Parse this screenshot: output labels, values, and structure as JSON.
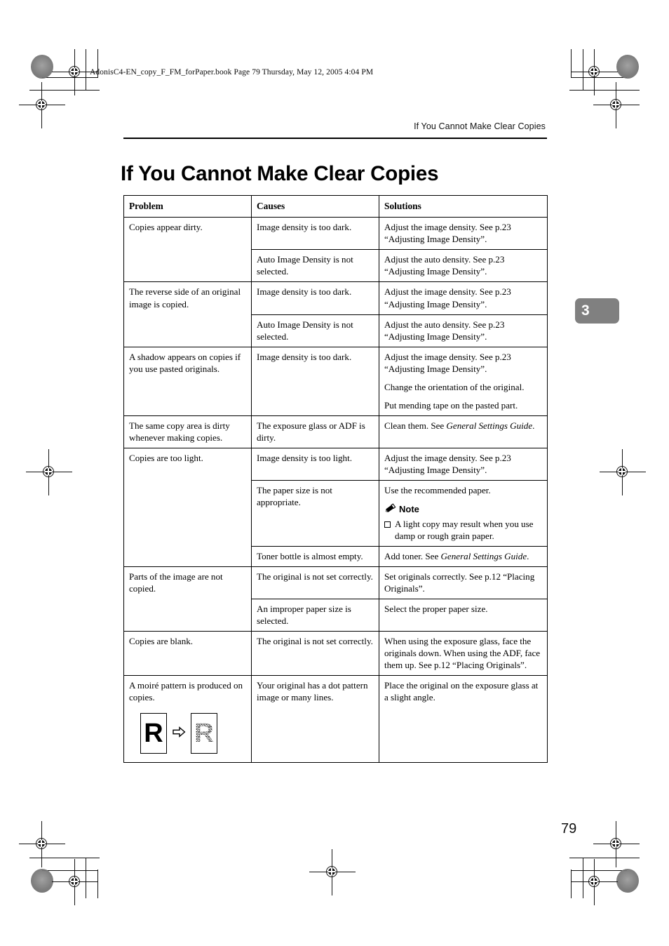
{
  "page": {
    "slug_line": "AdonisC4-EN_copy_F_FM_forPaper.book  Page 79  Thursday, May 12, 2005  4:04 PM",
    "running_head": "If You Cannot Make Clear Copies",
    "chapter_title": "If You Cannot Make Clear Copies",
    "chapter_tab": "3",
    "folio": "79",
    "accent_gray": "#808080",
    "rule_color": "#000000"
  },
  "table": {
    "headers": [
      "Problem",
      "Causes",
      "Solutions"
    ],
    "rows": [
      {
        "problem": "Copies appear dirty.",
        "problem_rowspan": 2,
        "cause": "Image density is too dark.",
        "solutions": [
          "Adjust the image density. See p.23 “Adjusting Image Density”."
        ]
      },
      {
        "cause": "Auto Image Density is not selected.",
        "solutions": [
          "Adjust the auto density. See p.23 “Adjusting Image Density”."
        ]
      },
      {
        "problem": "The reverse side of an original image is copied.",
        "problem_rowspan": 2,
        "cause": "Image density is too dark.",
        "solutions": [
          "Adjust the image density. See p.23 “Adjusting Image Density”."
        ]
      },
      {
        "cause": "Auto Image Density is not selected.",
        "solutions": [
          "Adjust the auto density. See p.23 “Adjusting Image Density”."
        ]
      },
      {
        "problem": "A shadow appears on copies if you use pasted originals.",
        "problem_rowspan": 1,
        "cause": "Image density is too dark.",
        "solutions": [
          "Adjust the image density. See p.23 “Adjusting Image Density”.",
          " Change the orientation of the original.",
          "Put mending tape on the pasted part."
        ]
      },
      {
        "problem": "The same copy area is dirty whenever making copies.",
        "problem_rowspan": 1,
        "cause": "The exposure glass or ADF is dirty.",
        "solution_rich": {
          "before": "Clean them. See ",
          "italic": "General Settings Guide",
          "after": "."
        }
      },
      {
        "problem": "Copies are too light.",
        "problem_rowspan": 3,
        "cause": "Image density is too light.",
        "solutions": [
          "Adjust the image density. See p.23 “Adjusting Image Density”."
        ]
      },
      {
        "cause": "The paper size is not appropriate.",
        "solutions": [
          "Use the recommended paper."
        ],
        "note": {
          "icon": "pencil-icon",
          "label": "Note",
          "items": [
            "A light copy may result when you use damp or rough grain paper."
          ]
        }
      },
      {
        "cause": "Toner bottle is almost empty.",
        "solution_rich": {
          "before": "Add toner. See ",
          "italic": "General Settings Guide",
          "after": "."
        }
      },
      {
        "problem": "Parts of the image are not copied.",
        "problem_rowspan": 2,
        "cause": "The original is not set correctly.",
        "solutions": [
          "Set originals correctly. See p.12 “Placing Originals”."
        ]
      },
      {
        "cause": "An improper paper size is selected.",
        "solutions": [
          "Select the proper paper size."
        ]
      },
      {
        "problem": "Copies are blank.",
        "problem_rowspan": 1,
        "cause": "The original is not set correctly.",
        "solutions": [
          "When using the exposure glass, face the originals down. When using the ADF, face them up. See p.12 “Placing Originals”."
        ]
      },
      {
        "problem": "A moiré pattern is produced on copies.",
        "problem_rowspan": 1,
        "problem_figure": {
          "left_glyph": "R",
          "arrow": "arrow-right-icon",
          "right_glyph": "R"
        },
        "cause": "Your original has a dot pattern image or many lines.",
        "solutions": [
          "Place the original on the exposure glass at a slight angle."
        ]
      }
    ]
  }
}
